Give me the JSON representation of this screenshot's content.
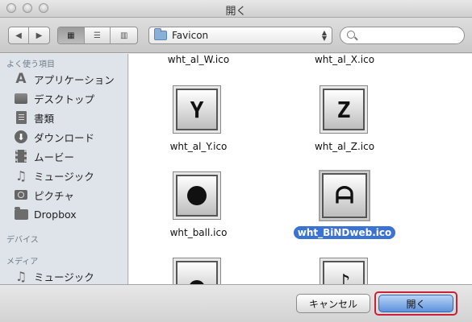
{
  "window": {
    "title": "開く"
  },
  "toolbar": {
    "nav_back_glyph": "◀",
    "nav_forward_glyph": "▶",
    "view_icon_glyph": "▦",
    "view_list_glyph": "☰",
    "view_column_glyph": "▥",
    "location": "Favicon",
    "search_placeholder": ""
  },
  "sidebar": {
    "favorites_heading": "よく使う項目",
    "favorites": [
      {
        "label": "アプリケーション",
        "icon": "applications-icon"
      },
      {
        "label": "デスクトップ",
        "icon": "desktop-icon"
      },
      {
        "label": "書類",
        "icon": "documents-icon"
      },
      {
        "label": "ダウンロード",
        "icon": "downloads-icon"
      },
      {
        "label": "ムービー",
        "icon": "movies-icon"
      },
      {
        "label": "ミュージック",
        "icon": "music-icon"
      },
      {
        "label": "ピクチャ",
        "icon": "pictures-icon"
      },
      {
        "label": "Dropbox",
        "icon": "folder-icon"
      }
    ],
    "devices_heading": "デバイス",
    "media_heading": "メディア",
    "media": [
      {
        "label": "ミュージック",
        "icon": "music-icon"
      }
    ]
  },
  "files": [
    {
      "name": "wht_al_W.ico",
      "glyph": ""
    },
    {
      "name": "wht_al_X.ico",
      "glyph": ""
    },
    {
      "name": "wht_al_Y.ico",
      "glyph": "Y"
    },
    {
      "name": "wht_al_Z.ico",
      "glyph": "Z"
    },
    {
      "name": "wht_ball.ico",
      "glyph": ""
    },
    {
      "name": "wht_BiNDweb.ico",
      "glyph": "ᗩ",
      "selected": true
    },
    {
      "name": "",
      "glyph": ""
    },
    {
      "name": "",
      "glyph": "♪"
    }
  ],
  "footer": {
    "cancel_label": "キャンセル",
    "open_label": "開く"
  },
  "colors": {
    "selection": "#3b73d4",
    "highlight_outline": "#c8213a",
    "sidebar_bg": "#dfe4ea"
  }
}
